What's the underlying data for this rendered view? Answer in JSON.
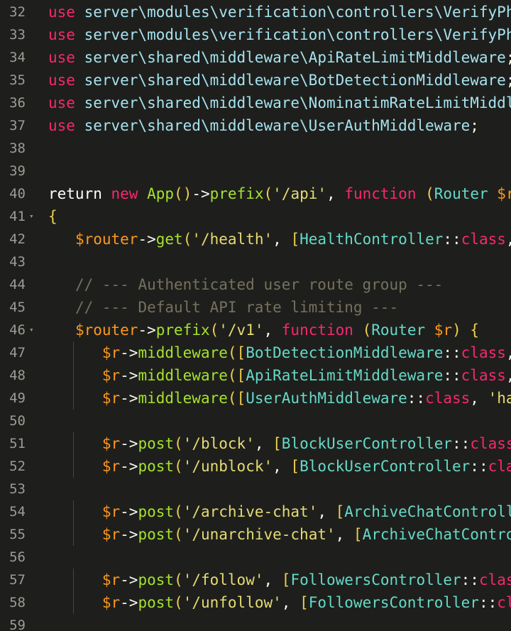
{
  "editor": {
    "lines": [
      {
        "n": "32",
        "parts": [
          [
            "kw",
            "use"
          ],
          [
            "op",
            " "
          ],
          [
            "ns",
            "server\\modules\\verification\\controllers\\VerifyPhoneNumberController"
          ]
        ]
      },
      {
        "n": "33",
        "parts": [
          [
            "kw",
            "use"
          ],
          [
            "op",
            " "
          ],
          [
            "ns",
            "server\\modules\\verification\\controllers\\VerifyPhoneNumberController"
          ]
        ]
      },
      {
        "n": "34",
        "parts": [
          [
            "kw",
            "use"
          ],
          [
            "op",
            " "
          ],
          [
            "ns",
            "server\\shared\\middleware\\ApiRateLimitMiddleware"
          ],
          [
            "op",
            ";"
          ]
        ]
      },
      {
        "n": "35",
        "parts": [
          [
            "kw",
            "use"
          ],
          [
            "op",
            " "
          ],
          [
            "ns",
            "server\\shared\\middleware\\BotDetectionMiddleware"
          ],
          [
            "op",
            ";"
          ]
        ]
      },
      {
        "n": "36",
        "parts": [
          [
            "kw",
            "use"
          ],
          [
            "op",
            " "
          ],
          [
            "ns",
            "server\\shared\\middleware\\NominatimRateLimitMiddleware"
          ]
        ]
      },
      {
        "n": "37",
        "parts": [
          [
            "kw",
            "use"
          ],
          [
            "op",
            " "
          ],
          [
            "ns",
            "server\\shared\\middleware\\UserAuthMiddleware"
          ],
          [
            "op",
            ";"
          ]
        ]
      },
      {
        "n": "38",
        "parts": []
      },
      {
        "n": "39",
        "parts": []
      },
      {
        "n": "40",
        "parts": [
          [
            "kwb",
            "return"
          ],
          [
            "op",
            " "
          ],
          [
            "kw",
            "new"
          ],
          [
            "op",
            " "
          ],
          [
            "fn",
            "App"
          ],
          [
            "paren",
            "()"
          ],
          [
            "op",
            "->"
          ],
          [
            "fnname",
            "prefix"
          ],
          [
            "paren",
            "("
          ],
          [
            "str",
            "'/api'"
          ],
          [
            "op",
            ", "
          ],
          [
            "kw",
            "function"
          ],
          [
            "op",
            " "
          ],
          [
            "paren",
            "("
          ],
          [
            "cls",
            "Router"
          ],
          [
            "op",
            " "
          ],
          [
            "var",
            "$router"
          ]
        ]
      },
      {
        "n": "41",
        "fold": true,
        "parts": [
          [
            "brk",
            "{"
          ]
        ]
      },
      {
        "n": "42",
        "parts": [
          [
            "op",
            "   "
          ],
          [
            "var",
            "$router"
          ],
          [
            "op",
            "->"
          ],
          [
            "fnname",
            "get"
          ],
          [
            "paren",
            "("
          ],
          [
            "str",
            "'/health'"
          ],
          [
            "op",
            ", "
          ],
          [
            "brk",
            "["
          ],
          [
            "cls",
            "HealthController"
          ],
          [
            "op",
            "::"
          ],
          [
            "kw",
            "class"
          ],
          [
            "op",
            ","
          ]
        ]
      },
      {
        "n": "43",
        "parts": []
      },
      {
        "n": "44",
        "parts": [
          [
            "op",
            "   "
          ],
          [
            "cm",
            "// --- Authenticated user route group ---"
          ]
        ]
      },
      {
        "n": "45",
        "parts": [
          [
            "op",
            "   "
          ],
          [
            "cm",
            "// --- Default API rate limiting ---"
          ]
        ]
      },
      {
        "n": "46",
        "fold": true,
        "parts": [
          [
            "op",
            "   "
          ],
          [
            "var",
            "$router"
          ],
          [
            "op",
            "->"
          ],
          [
            "fnname",
            "prefix"
          ],
          [
            "paren",
            "("
          ],
          [
            "str",
            "'/v1'"
          ],
          [
            "op",
            ", "
          ],
          [
            "kw",
            "function"
          ],
          [
            "op",
            " "
          ],
          [
            "paren",
            "("
          ],
          [
            "cls",
            "Router"
          ],
          [
            "op",
            " "
          ],
          [
            "var",
            "$r"
          ],
          [
            "paren",
            ")"
          ],
          [
            "op",
            " "
          ],
          [
            "brk",
            "{"
          ]
        ]
      },
      {
        "n": "47",
        "guide": true,
        "parts": [
          [
            "op",
            "      "
          ],
          [
            "var",
            "$r"
          ],
          [
            "op",
            "->"
          ],
          [
            "fnname",
            "middleware"
          ],
          [
            "paren",
            "("
          ],
          [
            "brk",
            "["
          ],
          [
            "cls",
            "BotDetectionMiddleware"
          ],
          [
            "op",
            "::"
          ],
          [
            "kw",
            "class"
          ],
          [
            "op",
            ","
          ]
        ]
      },
      {
        "n": "48",
        "guide": true,
        "parts": [
          [
            "op",
            "      "
          ],
          [
            "var",
            "$r"
          ],
          [
            "op",
            "->"
          ],
          [
            "fnname",
            "middleware"
          ],
          [
            "paren",
            "("
          ],
          [
            "brk",
            "["
          ],
          [
            "cls",
            "ApiRateLimitMiddleware"
          ],
          [
            "op",
            "::"
          ],
          [
            "kw",
            "class"
          ],
          [
            "op",
            ","
          ]
        ]
      },
      {
        "n": "49",
        "guide": true,
        "parts": [
          [
            "op",
            "      "
          ],
          [
            "var",
            "$r"
          ],
          [
            "op",
            "->"
          ],
          [
            "fnname",
            "middleware"
          ],
          [
            "paren",
            "("
          ],
          [
            "brk",
            "["
          ],
          [
            "cls",
            "UserAuthMiddleware"
          ],
          [
            "op",
            "::"
          ],
          [
            "kw",
            "class"
          ],
          [
            "op",
            ", "
          ],
          [
            "str",
            "'handle'"
          ]
        ]
      },
      {
        "n": "50",
        "parts": []
      },
      {
        "n": "51",
        "guide": true,
        "parts": [
          [
            "op",
            "      "
          ],
          [
            "var",
            "$r"
          ],
          [
            "op",
            "->"
          ],
          [
            "fnname",
            "post"
          ],
          [
            "paren",
            "("
          ],
          [
            "str",
            "'/block'"
          ],
          [
            "op",
            ", "
          ],
          [
            "brk",
            "["
          ],
          [
            "cls",
            "BlockUserController"
          ],
          [
            "op",
            "::"
          ],
          [
            "kw",
            "class"
          ],
          [
            "op",
            ","
          ]
        ]
      },
      {
        "n": "52",
        "guide": true,
        "parts": [
          [
            "op",
            "      "
          ],
          [
            "var",
            "$r"
          ],
          [
            "op",
            "->"
          ],
          [
            "fnname",
            "post"
          ],
          [
            "paren",
            "("
          ],
          [
            "str",
            "'/unblock'"
          ],
          [
            "op",
            ", "
          ],
          [
            "brk",
            "["
          ],
          [
            "cls",
            "BlockUserController"
          ],
          [
            "op",
            "::"
          ],
          [
            "kw",
            "class"
          ]
        ]
      },
      {
        "n": "53",
        "parts": []
      },
      {
        "n": "54",
        "guide": true,
        "parts": [
          [
            "op",
            "      "
          ],
          [
            "var",
            "$r"
          ],
          [
            "op",
            "->"
          ],
          [
            "fnname",
            "post"
          ],
          [
            "paren",
            "("
          ],
          [
            "str",
            "'/archive-chat'"
          ],
          [
            "op",
            ", "
          ],
          [
            "brk",
            "["
          ],
          [
            "cls",
            "ArchiveChatController"
          ]
        ]
      },
      {
        "n": "55",
        "guide": true,
        "parts": [
          [
            "op",
            "      "
          ],
          [
            "var",
            "$r"
          ],
          [
            "op",
            "->"
          ],
          [
            "fnname",
            "post"
          ],
          [
            "paren",
            "("
          ],
          [
            "str",
            "'/unarchive-chat'"
          ],
          [
            "op",
            ", "
          ],
          [
            "brk",
            "["
          ],
          [
            "cls",
            "ArchiveChatController"
          ]
        ]
      },
      {
        "n": "56",
        "parts": []
      },
      {
        "n": "57",
        "guide": true,
        "parts": [
          [
            "op",
            "      "
          ],
          [
            "var",
            "$r"
          ],
          [
            "op",
            "->"
          ],
          [
            "fnname",
            "post"
          ],
          [
            "paren",
            "("
          ],
          [
            "str",
            "'/follow'"
          ],
          [
            "op",
            ", "
          ],
          [
            "brk",
            "["
          ],
          [
            "cls",
            "FollowersController"
          ],
          [
            "op",
            "::"
          ],
          [
            "kw",
            "class"
          ]
        ]
      },
      {
        "n": "58",
        "guide": true,
        "parts": [
          [
            "op",
            "      "
          ],
          [
            "var",
            "$r"
          ],
          [
            "op",
            "->"
          ],
          [
            "fnname",
            "post"
          ],
          [
            "paren",
            "("
          ],
          [
            "str",
            "'/unfollow'"
          ],
          [
            "op",
            ", "
          ],
          [
            "brk",
            "["
          ],
          [
            "cls",
            "FollowersController"
          ],
          [
            "op",
            "::"
          ],
          [
            "kw",
            "class"
          ]
        ]
      },
      {
        "n": "59",
        "parts": []
      }
    ]
  }
}
